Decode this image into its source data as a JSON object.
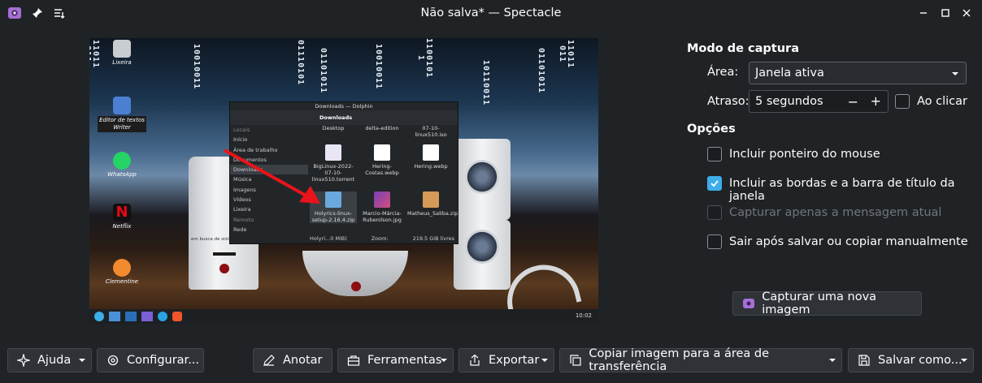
{
  "window": {
    "title": "Não salva* — Spectacle",
    "icons": [
      "spectacle-app-icon",
      "pin-icon",
      "menu-icon",
      "minimize-icon",
      "maximize-icon",
      "close-icon"
    ]
  },
  "preview": {
    "binary_strings": [
      "11011011",
      "10010011",
      "01110101",
      "01101011",
      "10010011",
      "11001011",
      "10110011",
      "01101011",
      "11011011"
    ],
    "desktop_icons": [
      {
        "name": "trash",
        "label": "Lixeira"
      },
      {
        "name": "writer",
        "label": "Editor de textos Writer"
      },
      {
        "name": "whatsapp",
        "label": "WhatsApp"
      },
      {
        "name": "netflix",
        "label": "Netflix"
      },
      {
        "name": "clementine",
        "label": "Clementine"
      }
    ],
    "dolphin": {
      "title": "Downloads — Dolphin",
      "location": "Downloads",
      "places_header": "Locais",
      "places": [
        "Início",
        "Área de trabalho",
        "Documentos",
        "Downloads",
        "Música",
        "Imagens",
        "Vídeos",
        "Lixeira"
      ],
      "remote_header": "Remoto",
      "remote": [
        "Rede"
      ],
      "top_row": [
        "Desktop",
        "delta-edition",
        "07-10-linux510.iso"
      ],
      "files": [
        {
          "name": "BigLinux-2022-07-10-linux510.torrent"
        },
        {
          "name": "Hering-Costas.webp"
        },
        {
          "name": "Hering.webp"
        },
        {
          "name": "Holyrics-linux-setup-2.16.4.zip"
        },
        {
          "name": "Marcio-Márcia-Rubenilson.jpg"
        },
        {
          "name": "Matheus_Saliba.zip"
        }
      ],
      "status_left": "Holyri...0 MiB)",
      "zoom_label": "Zoom:",
      "free_space": "219.5 GiB livres"
    },
    "pc_label": "em busca de sistema",
    "clock": "10:02"
  },
  "options": {
    "capture_mode_heading": "Modo de captura",
    "area_label": "Área:",
    "area_value": "Janela ativa",
    "delay_label": "Atraso:",
    "delay_value": "5 segundos",
    "on_click_label": "Ao clicar",
    "options_heading": "Opções",
    "checkboxes": [
      {
        "label": "Incluir ponteiro do mouse",
        "checked": false,
        "enabled": true
      },
      {
        "label": "Incluir as bordas e a barra de título da janela",
        "checked": true,
        "enabled": true
      },
      {
        "label": "Capturar apenas a mensagem atual",
        "checked": false,
        "enabled": false
      },
      {
        "label": "Sair após salvar ou copiar manualmente",
        "checked": false,
        "enabled": true
      }
    ],
    "new_capture_button": "Capturar uma nova imagem"
  },
  "bottom_bar": {
    "help": "Ajuda",
    "configure": "Configurar...",
    "annotate": "Anotar",
    "tools": "Ferramentas",
    "export": "Exportar",
    "copy": "Copiar imagem para a área de transferência",
    "save": "Salvar como..."
  },
  "colors": {
    "background": "#202326",
    "accent": "#3daee9",
    "button": "#2f3338",
    "arrow_red": "#e8141a"
  }
}
